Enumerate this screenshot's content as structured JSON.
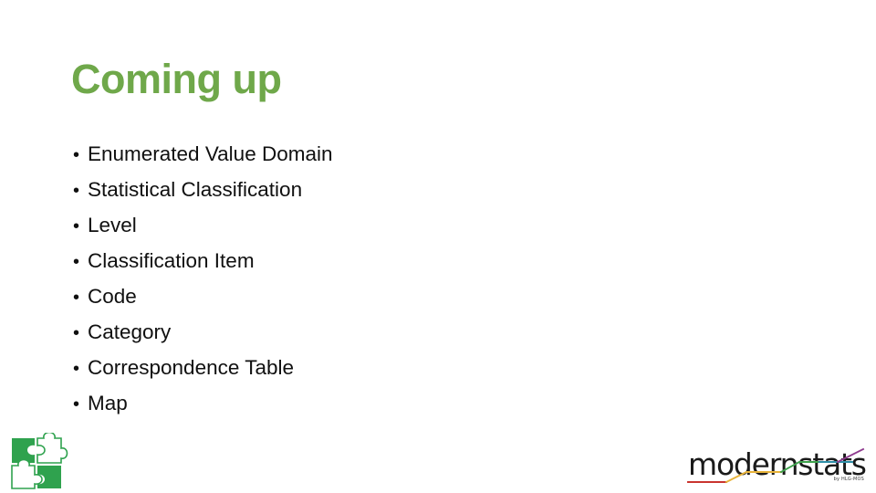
{
  "slide": {
    "background_color": "#FFFFFF",
    "title": "Coming up",
    "title_color": "#6FA84A",
    "body_text_color": "#101010"
  },
  "bullets": [
    {
      "marker": "•",
      "label": "Enumerated Value Domain"
    },
    {
      "marker": "•",
      "label": "Statistical Classification"
    },
    {
      "marker": "•",
      "label": "Level"
    },
    {
      "marker": "•",
      "label": "Classification Item"
    },
    {
      "marker": "•",
      "label": "Code"
    },
    {
      "marker": "•",
      "label": "Category"
    },
    {
      "marker": "•",
      "label": "Correspondence Table"
    },
    {
      "marker": "•",
      "label": "Map"
    }
  ],
  "puzzle_logo": {
    "name": "puzzle-pieces-logo",
    "fill_color": "#2FA24E",
    "outline_color": "#2FA24E"
  },
  "modernstats_logo": {
    "wordmark": "modernstats",
    "tagline": "by HLG-MOS",
    "text_color": "#1A1A1A",
    "line_colors": [
      "#C9342F",
      "#E8B33A",
      "#3FA34D",
      "#2E8FA8",
      "#8E3A8E"
    ]
  }
}
